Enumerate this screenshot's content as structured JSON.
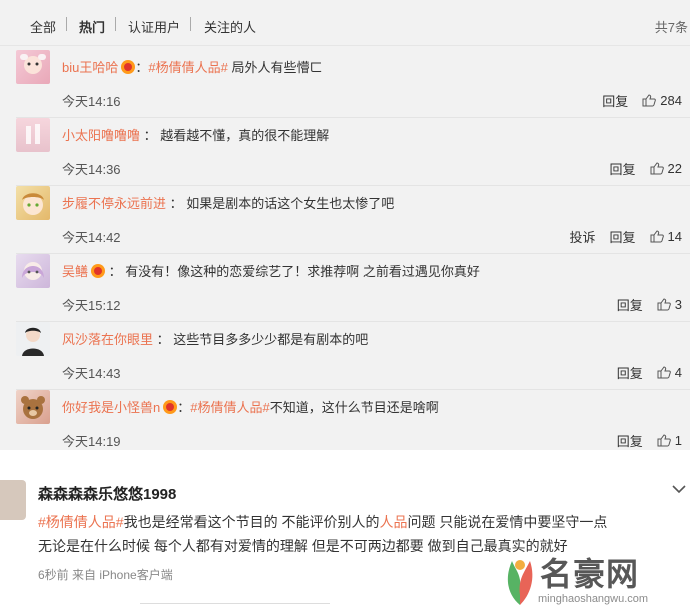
{
  "filters": {
    "all": "全部",
    "hot": "热门",
    "verified": "认证用户",
    "following": "关注的人",
    "total": "共7条"
  },
  "comments": [
    {
      "username": "biu王哈哈",
      "has_badge": true,
      "topic": "#杨倩倩人品#",
      "text": " 局外人有些懵ㄈ",
      "time": "今天14:16",
      "report": "",
      "reply": "回复",
      "likes": "284"
    },
    {
      "username": "小太阳噜噜噜",
      "has_badge": false,
      "topic": "",
      "text": "越看越不懂，真的很不能理解",
      "time": "今天14:36",
      "report": "",
      "reply": "回复",
      "likes": "22"
    },
    {
      "username": "步履不停永远前进",
      "has_badge": false,
      "topic": "",
      "text": "如果是剧本的话这个女生也太惨了吧",
      "time": "今天14:42",
      "report": "投诉",
      "reply": "回复",
      "likes": "14"
    },
    {
      "username": "吴鳝",
      "has_badge": true,
      "topic": "",
      "text": "有没有！像这种的恋爱综艺了！求推荐啊 之前看过遇见你真好",
      "time": "今天15:12",
      "report": "",
      "reply": "回复",
      "likes": "3"
    },
    {
      "username": "风沙落在你眼里",
      "has_badge": false,
      "topic": "",
      "text": "这些节目多多少少都是有剧本的吧",
      "time": "今天14:43",
      "report": "",
      "reply": "回复",
      "likes": "4"
    },
    {
      "username": "你好我是小怪兽n",
      "has_badge": true,
      "topic": "#杨倩倩人品#",
      "text": "不知道，这什么节目还是啥啊",
      "time": "今天14:19",
      "report": "",
      "reply": "回复",
      "likes": "1"
    }
  ],
  "expanded": {
    "username": "森森森森乐悠悠1998",
    "line1_topic": "#杨倩倩人品#",
    "line1_a": "我也是经常看这个节目的 不能评价别人的",
    "line1_hl": "人品",
    "line1_b": "问题 只能说在爱情中要坚守一点",
    "line2": "无论是在什么时候 每个人都有对爱情的理解 但是不可两边都要 做到自己最真实的就好",
    "meta": "6秒前 来自 iPhone客户端"
  },
  "watermark": {
    "title": "名豪网",
    "url": "minghaoshangwu.com"
  },
  "colors": {
    "accent": "#eb7350",
    "panel": "#f2f2f2"
  }
}
